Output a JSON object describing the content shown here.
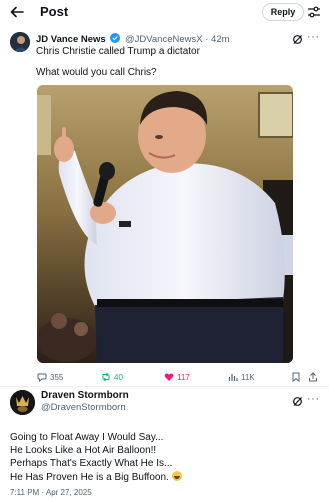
{
  "header": {
    "title": "Post",
    "reply_label": "Reply"
  },
  "tweet": {
    "author_name": "JD Vance News",
    "author_handle": "@JDVanceNewsX",
    "separator": "·",
    "time_ago": "42m",
    "text_line1": "Chris Christie called Trump a dictator",
    "text_line2": "What would you call Chris?",
    "stats": {
      "replies": "355",
      "reposts": "40",
      "likes": "117",
      "views": "11K"
    }
  },
  "reply": {
    "author_name": "Draven Stormborn",
    "author_handle": "@DravenStormborn",
    "lines": [
      "Going to Float Away I Would Say...",
      "He Looks Like a Hot Air Balloon!!",
      "Perhaps That's Exactly What He Is...",
      "He Has Proven He is a Big Buffoon."
    ],
    "timestamp": "7:11 PM · Apr 27, 2025"
  },
  "colors": {
    "text": "#0f1419",
    "secondary": "#536471",
    "verified": "#1d9bf0",
    "repost": "#00ba7c",
    "like": "#f91880",
    "border": "#cfd9de"
  },
  "icons": [
    "back-arrow-icon",
    "adjust-icon",
    "verified-badge-icon",
    "grok-icon",
    "more-icon",
    "reply-icon",
    "repost-icon",
    "like-icon",
    "views-icon",
    "bookmark-icon",
    "share-icon"
  ]
}
